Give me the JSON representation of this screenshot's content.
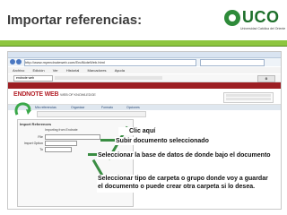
{
  "slide": {
    "title": "Importar referencias:"
  },
  "logo": {
    "brand": "UCO",
    "tagline": "Universidad Católica del Oriente"
  },
  "browser": {
    "address": "http://www.myendnoteweb.com/EndNoteWeb.html",
    "menu": [
      "Archivo",
      "Edición",
      "Ver",
      "Historial",
      "Marcadores",
      "Ayuda"
    ],
    "toolbar_field": "endnote web"
  },
  "endnote": {
    "logo_main": "ENDNOTE WEB",
    "logo_sub": "WEB OF KNOWLEDGE",
    "nav": [
      "Mis referencias",
      "Organizar",
      "Formato",
      "Opciones"
    ],
    "panel_title": "Import References",
    "panel_subtitle": "Importing from Endnote",
    "rows": [
      {
        "label": "File",
        "value": "C:\\Users\\Endnote\\Desktop\\ref.txt"
      },
      {
        "label": "Import Option",
        "value": "Pubmed"
      },
      {
        "label": "To",
        "value": "Unfiled"
      }
    ]
  },
  "callouts": {
    "clic": "Clic aquí",
    "subir": "Subir documento seleccionado",
    "base": "Seleccionar la base de datos de donde bajo el documento",
    "carpeta_line1": "Seleccionar tipo de carpeta o grupo donde voy a guardar",
    "carpeta_line2": "el documento o puede crear otra carpeta si lo desea."
  },
  "colors": {
    "accent_green": "#8dc63f",
    "endnote_red": "#9c1e23"
  }
}
